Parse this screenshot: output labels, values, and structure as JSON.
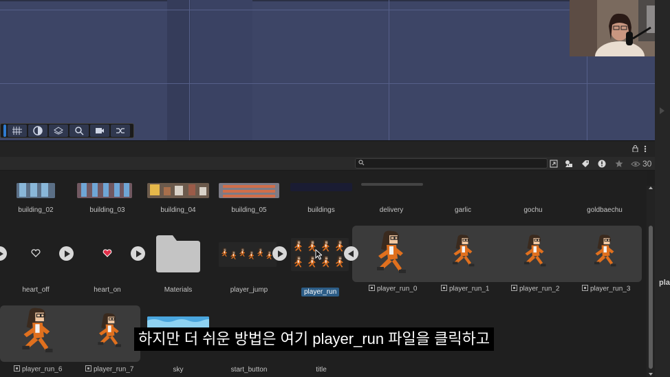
{
  "scene": {
    "tools": [
      "grid-icon",
      "sphere-icon",
      "layers-icon",
      "search-icon",
      "camera-icon",
      "shuffle-icon"
    ]
  },
  "toolbar": {
    "visible_count": "30"
  },
  "assets_row1": [
    "building_02",
    "building_03",
    "building_04",
    "building_05",
    "buildings",
    "delivery",
    "garlic",
    "gochu",
    "goldbaechu"
  ],
  "assets_row2": [
    "heart_off",
    "heart_on",
    "Materials",
    "player_jump",
    "player_run",
    "player_run_0",
    "player_run_1",
    "player_run_2",
    "player_run_3"
  ],
  "assets_row3": [
    "player_run_6",
    "player_run_7",
    "sky",
    "start_button",
    "title"
  ],
  "right_panel_text": "pla",
  "subtitle": "하지만 더 쉬운 방법은 여기 player_run 파일을 클릭하고",
  "colors": {
    "scene_bg": "#3d4566",
    "selected": "#2c5d87",
    "runner_orange": "#e0701e"
  }
}
